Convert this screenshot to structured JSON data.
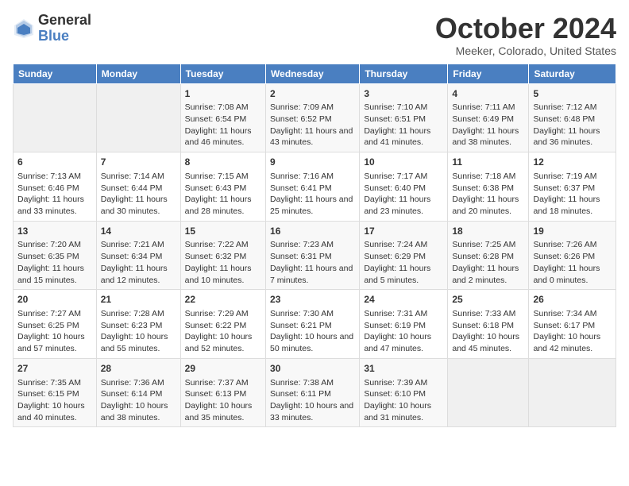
{
  "logo": {
    "general": "General",
    "blue": "Blue"
  },
  "title": "October 2024",
  "location": "Meeker, Colorado, United States",
  "days_of_week": [
    "Sunday",
    "Monday",
    "Tuesday",
    "Wednesday",
    "Thursday",
    "Friday",
    "Saturday"
  ],
  "weeks": [
    [
      {
        "day": "",
        "info": ""
      },
      {
        "day": "",
        "info": ""
      },
      {
        "day": "1",
        "info": "Sunrise: 7:08 AM\nSunset: 6:54 PM\nDaylight: 11 hours and 46 minutes."
      },
      {
        "day": "2",
        "info": "Sunrise: 7:09 AM\nSunset: 6:52 PM\nDaylight: 11 hours and 43 minutes."
      },
      {
        "day": "3",
        "info": "Sunrise: 7:10 AM\nSunset: 6:51 PM\nDaylight: 11 hours and 41 minutes."
      },
      {
        "day": "4",
        "info": "Sunrise: 7:11 AM\nSunset: 6:49 PM\nDaylight: 11 hours and 38 minutes."
      },
      {
        "day": "5",
        "info": "Sunrise: 7:12 AM\nSunset: 6:48 PM\nDaylight: 11 hours and 36 minutes."
      }
    ],
    [
      {
        "day": "6",
        "info": "Sunrise: 7:13 AM\nSunset: 6:46 PM\nDaylight: 11 hours and 33 minutes."
      },
      {
        "day": "7",
        "info": "Sunrise: 7:14 AM\nSunset: 6:44 PM\nDaylight: 11 hours and 30 minutes."
      },
      {
        "day": "8",
        "info": "Sunrise: 7:15 AM\nSunset: 6:43 PM\nDaylight: 11 hours and 28 minutes."
      },
      {
        "day": "9",
        "info": "Sunrise: 7:16 AM\nSunset: 6:41 PM\nDaylight: 11 hours and 25 minutes."
      },
      {
        "day": "10",
        "info": "Sunrise: 7:17 AM\nSunset: 6:40 PM\nDaylight: 11 hours and 23 minutes."
      },
      {
        "day": "11",
        "info": "Sunrise: 7:18 AM\nSunset: 6:38 PM\nDaylight: 11 hours and 20 minutes."
      },
      {
        "day": "12",
        "info": "Sunrise: 7:19 AM\nSunset: 6:37 PM\nDaylight: 11 hours and 18 minutes."
      }
    ],
    [
      {
        "day": "13",
        "info": "Sunrise: 7:20 AM\nSunset: 6:35 PM\nDaylight: 11 hours and 15 minutes."
      },
      {
        "day": "14",
        "info": "Sunrise: 7:21 AM\nSunset: 6:34 PM\nDaylight: 11 hours and 12 minutes."
      },
      {
        "day": "15",
        "info": "Sunrise: 7:22 AM\nSunset: 6:32 PM\nDaylight: 11 hours and 10 minutes."
      },
      {
        "day": "16",
        "info": "Sunrise: 7:23 AM\nSunset: 6:31 PM\nDaylight: 11 hours and 7 minutes."
      },
      {
        "day": "17",
        "info": "Sunrise: 7:24 AM\nSunset: 6:29 PM\nDaylight: 11 hours and 5 minutes."
      },
      {
        "day": "18",
        "info": "Sunrise: 7:25 AM\nSunset: 6:28 PM\nDaylight: 11 hours and 2 minutes."
      },
      {
        "day": "19",
        "info": "Sunrise: 7:26 AM\nSunset: 6:26 PM\nDaylight: 11 hours and 0 minutes."
      }
    ],
    [
      {
        "day": "20",
        "info": "Sunrise: 7:27 AM\nSunset: 6:25 PM\nDaylight: 10 hours and 57 minutes."
      },
      {
        "day": "21",
        "info": "Sunrise: 7:28 AM\nSunset: 6:23 PM\nDaylight: 10 hours and 55 minutes."
      },
      {
        "day": "22",
        "info": "Sunrise: 7:29 AM\nSunset: 6:22 PM\nDaylight: 10 hours and 52 minutes."
      },
      {
        "day": "23",
        "info": "Sunrise: 7:30 AM\nSunset: 6:21 PM\nDaylight: 10 hours and 50 minutes."
      },
      {
        "day": "24",
        "info": "Sunrise: 7:31 AM\nSunset: 6:19 PM\nDaylight: 10 hours and 47 minutes."
      },
      {
        "day": "25",
        "info": "Sunrise: 7:33 AM\nSunset: 6:18 PM\nDaylight: 10 hours and 45 minutes."
      },
      {
        "day": "26",
        "info": "Sunrise: 7:34 AM\nSunset: 6:17 PM\nDaylight: 10 hours and 42 minutes."
      }
    ],
    [
      {
        "day": "27",
        "info": "Sunrise: 7:35 AM\nSunset: 6:15 PM\nDaylight: 10 hours and 40 minutes."
      },
      {
        "day": "28",
        "info": "Sunrise: 7:36 AM\nSunset: 6:14 PM\nDaylight: 10 hours and 38 minutes."
      },
      {
        "day": "29",
        "info": "Sunrise: 7:37 AM\nSunset: 6:13 PM\nDaylight: 10 hours and 35 minutes."
      },
      {
        "day": "30",
        "info": "Sunrise: 7:38 AM\nSunset: 6:11 PM\nDaylight: 10 hours and 33 minutes."
      },
      {
        "day": "31",
        "info": "Sunrise: 7:39 AM\nSunset: 6:10 PM\nDaylight: 10 hours and 31 minutes."
      },
      {
        "day": "",
        "info": ""
      },
      {
        "day": "",
        "info": ""
      }
    ]
  ]
}
